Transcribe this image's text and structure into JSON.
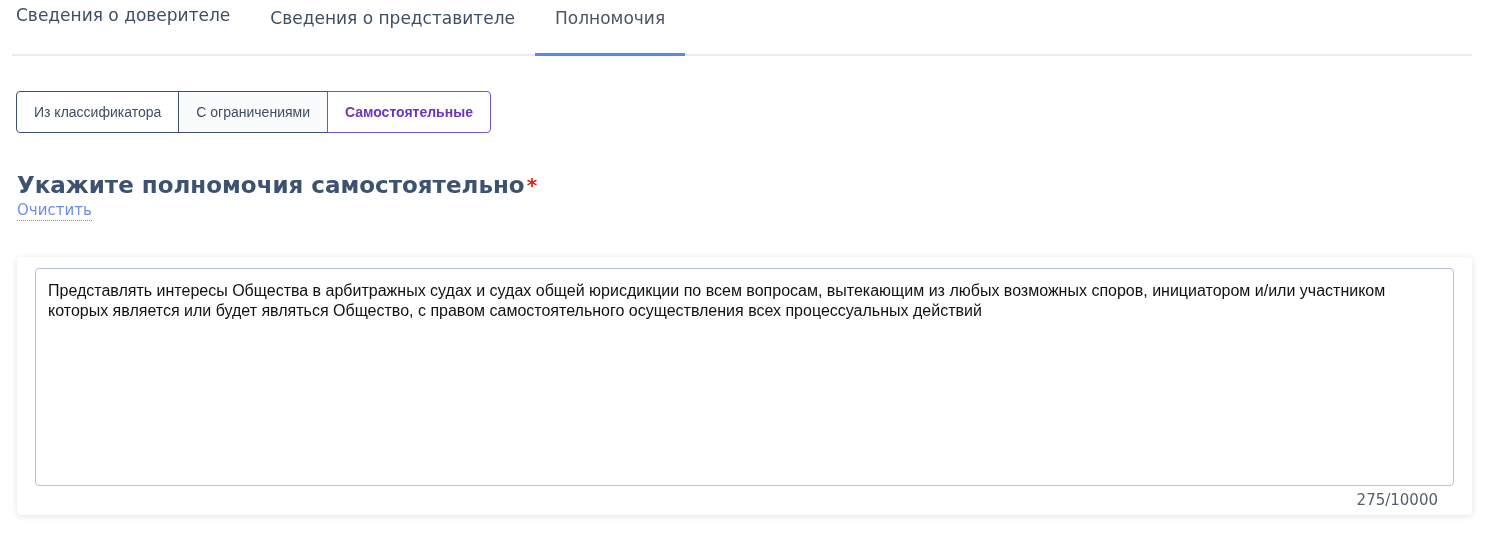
{
  "tabs": [
    {
      "label": "Сведения о доверителе",
      "selected": false
    },
    {
      "label": "Сведения о представителе",
      "selected": false
    },
    {
      "label": "Полномочия",
      "selected": true
    }
  ],
  "segments": [
    {
      "label": "Из классификатора",
      "selected": false
    },
    {
      "label": "С ограничениями",
      "selected": false
    },
    {
      "label": "Самостоятельные",
      "selected": true
    }
  ],
  "heading": {
    "text": "Укажите полномочия самостоятельно",
    "required_mark": "*"
  },
  "clear_link": "Очистить",
  "textarea": {
    "value": "Представлять интересы Общества в арбитражных судах и судах общей юрисдикции по всем вопросам, вытекающим из любых возможных споров, инициатором и/или участником которых является или будет являться Общество, с правом самостоятельного осуществления всех процессуальных действий",
    "counter": "275/10000"
  }
}
